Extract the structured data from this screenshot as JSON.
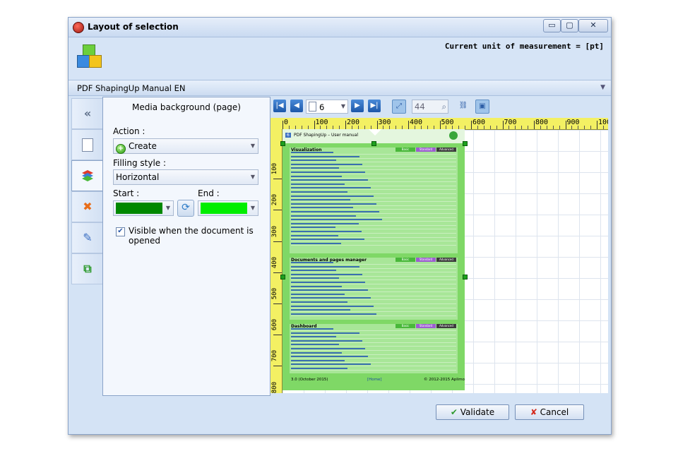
{
  "window": {
    "title": "Layout of selection",
    "controls": {
      "minimize": "▭",
      "maximize": "▢",
      "close": "✕"
    }
  },
  "header": {
    "unit_text": "Current unit of measurement = [pt]"
  },
  "document": {
    "name": "PDF ShapingUp Manual EN"
  },
  "panel": {
    "title": "Media background (page)",
    "action_label": "Action :",
    "action_value": "Create",
    "filling_label": "Filling style :",
    "filling_value": "Horizontal",
    "start_label": "Start :",
    "end_label": "End :",
    "start_color": "#008800",
    "end_color": "#00ee00",
    "visible_label": "Visible when the document is opened",
    "visible_checked": true
  },
  "viewer": {
    "page_number": "6",
    "zoom": "44",
    "ruler_h": [
      "0",
      "100",
      "200",
      "300",
      "400",
      "500",
      "600",
      "700",
      "800",
      "900",
      "1000"
    ],
    "ruler_v": [
      "100",
      "200",
      "300",
      "400",
      "500",
      "600",
      "700",
      "800"
    ],
    "page_bg": "#7fd866"
  },
  "page_preview": {
    "doc_title": "PDF ShapingUp – User manual",
    "page_badge": "6",
    "section1_title": "Visualization",
    "section2_title": "Documents and pages manager",
    "section3_title": "Dashboard",
    "col_headers": [
      "Basic",
      "Standard",
      "Advanced"
    ],
    "footer_left": "3.0 (October 2015)",
    "footer_mid": "[Home]",
    "footer_right": "© 2012-2015 Aplimo"
  },
  "buttons": {
    "validate": "Validate",
    "cancel": "Cancel"
  },
  "colors": {
    "accent": "#2c6fbf",
    "window_bg": "#d4e3f5",
    "ruler": "#f3f063"
  }
}
